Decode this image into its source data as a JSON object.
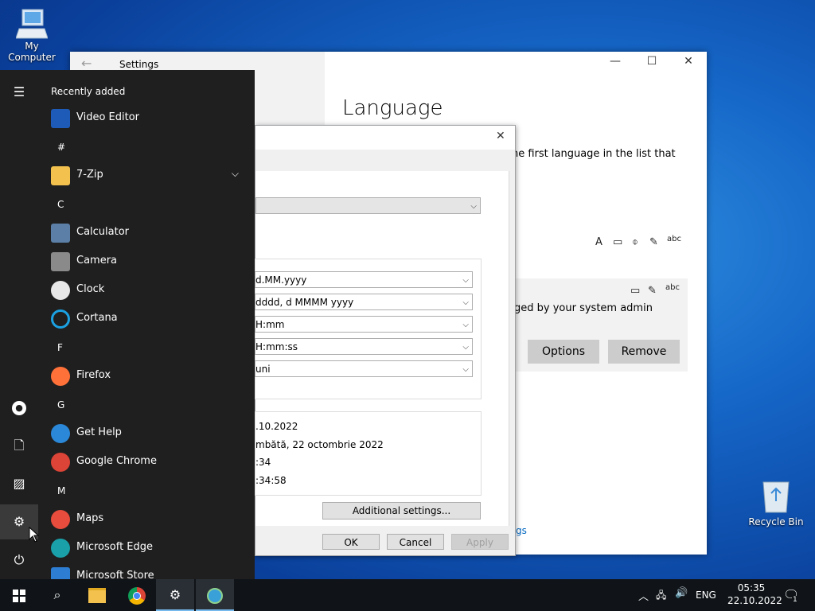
{
  "desktop": {
    "my_computer": "My Computer",
    "recycle_bin": "Recycle Bin"
  },
  "settings": {
    "title": "Settings",
    "heading": "Language",
    "paragraph_fragment": "ne first language in the list that",
    "card_text_fragment": "ged by your system admin",
    "options_label": "Options",
    "remove_label": "Remove",
    "link_fragment": "gs"
  },
  "region_dialog": {
    "formats": {
      "short_date": "d.MM.yyyy",
      "long_date": "dddd, d MMMM yyyy",
      "short_time": "H:mm",
      "long_time": "H:mm:ss",
      "first_day": "uni"
    },
    "examples": {
      "short_date": ".10.2022",
      "long_date": "mbătă, 22 octombrie 2022",
      "short_time": ":34",
      "long_time": ":34:58"
    },
    "additional_settings": "Additional settings...",
    "ok": "OK",
    "cancel": "Cancel",
    "apply": "Apply"
  },
  "start_menu": {
    "recently_added": "Recently added",
    "items": [
      {
        "type": "app",
        "label": "Video Editor",
        "icon": "video-editor-icon",
        "color": "#1e5bb8"
      },
      {
        "type": "letter",
        "label": "#"
      },
      {
        "type": "app",
        "label": "7-Zip",
        "icon": "folder-icon",
        "color": "#f2c14e",
        "expand": true
      },
      {
        "type": "letter",
        "label": "C"
      },
      {
        "type": "app",
        "label": "Calculator",
        "icon": "calculator-icon",
        "color": "#5b7fa6"
      },
      {
        "type": "app",
        "label": "Camera",
        "icon": "camera-icon",
        "color": "#8a8a8a"
      },
      {
        "type": "app",
        "label": "Clock",
        "icon": "clock-icon",
        "color": "#e8e8e8"
      },
      {
        "type": "app",
        "label": "Cortana",
        "icon": "cortana-icon",
        "color": "#1ba1e2"
      },
      {
        "type": "letter",
        "label": "F"
      },
      {
        "type": "app",
        "label": "Firefox",
        "icon": "firefox-icon",
        "color": "#ff7139"
      },
      {
        "type": "letter",
        "label": "G"
      },
      {
        "type": "app",
        "label": "Get Help",
        "icon": "get-help-icon",
        "color": "#2b88d8"
      },
      {
        "type": "app",
        "label": "Google Chrome",
        "icon": "chrome-icon",
        "color": "#db4437"
      },
      {
        "type": "letter",
        "label": "M"
      },
      {
        "type": "app",
        "label": "Maps",
        "icon": "maps-icon",
        "color": "#e74c3c"
      },
      {
        "type": "app",
        "label": "Microsoft Edge",
        "icon": "edge-icon",
        "color": "#1aa0a8"
      },
      {
        "type": "app",
        "label": "Microsoft Store",
        "icon": "store-icon",
        "color": "#2d7dd2"
      }
    ]
  },
  "taskbar": {
    "language": "ENG",
    "time": "05:35",
    "date": "22.10.2022",
    "notification_count": "1"
  }
}
